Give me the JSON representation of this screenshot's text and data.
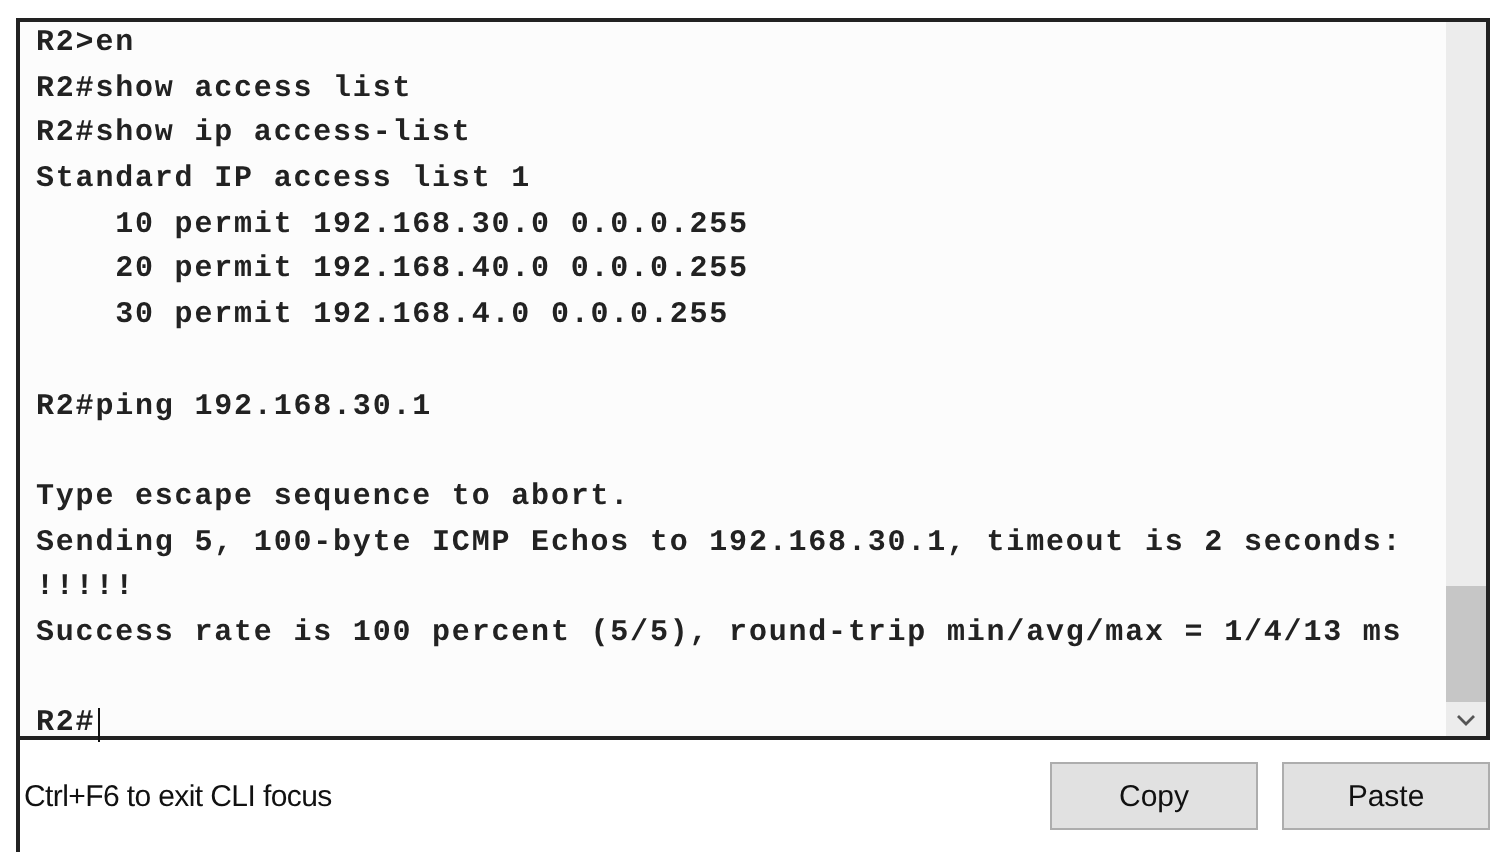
{
  "terminal": {
    "blocks": [
      [
        "R2>en",
        "R2#show access list",
        "R2#show ip access-list",
        "Standard IP access list 1",
        "    10 permit 192.168.30.0 0.0.0.255",
        "    20 permit 192.168.40.0 0.0.0.255",
        "    30 permit 192.168.4.0 0.0.0.255"
      ],
      [
        "R2#ping 192.168.30.1"
      ],
      [
        "Type escape sequence to abort.",
        "Sending 5, 100-byte ICMP Echos to 192.168.30.1, timeout is 2 seconds:",
        "!!!!!",
        "Success rate is 100 percent (5/5), round-trip min/avg/max = 1/4/13 ms"
      ]
    ],
    "prompt": "R2#"
  },
  "footer": {
    "hint": "Ctrl+F6 to exit CLI focus",
    "buttons": [
      "Copy",
      "Paste"
    ]
  }
}
